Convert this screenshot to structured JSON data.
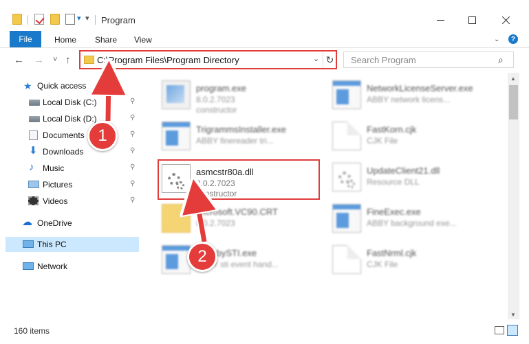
{
  "window": {
    "title": "Program",
    "quick_access_dropdown": "▾",
    "minimize": "—",
    "maximize": "☐",
    "close": "✕"
  },
  "ribbon": {
    "tabs": [
      "File",
      "Home",
      "Share",
      "View"
    ],
    "expand_glyph": "⌄",
    "help_glyph": "?"
  },
  "nav_buttons": {
    "back": "←",
    "forward": "→",
    "recent": "˅",
    "up": "↑"
  },
  "address": {
    "path": "C:\\Program Files\\Program Directory",
    "dropdown_glyph": "⌄",
    "refresh_glyph": "↻"
  },
  "search": {
    "placeholder": "Search Program",
    "icon_glyph": "⌕"
  },
  "sidebar": {
    "pin_glyph": "📌",
    "items": [
      {
        "label": "Quick access",
        "icon": "star-icon",
        "pinned": false
      },
      {
        "label": "Local Disk (C:)",
        "icon": "disk-icon",
        "pinned": true
      },
      {
        "label": "Local Disk (D:)",
        "icon": "disk-icon",
        "pinned": true
      },
      {
        "label": "Documents",
        "icon": "documents-icon",
        "pinned": true
      },
      {
        "label": "Downloads",
        "icon": "download-icon",
        "pinned": true
      },
      {
        "label": "Music",
        "icon": "music-icon",
        "pinned": true
      },
      {
        "label": "Pictures",
        "icon": "pictures-icon",
        "pinned": true
      },
      {
        "label": "Videos",
        "icon": "videos-icon",
        "pinned": true
      },
      {
        "label": "OneDrive",
        "icon": "cloud-icon",
        "pinned": false
      },
      {
        "label": "This PC",
        "icon": "computer-icon",
        "pinned": false,
        "selected": true
      },
      {
        "label": "Network",
        "icon": "network-icon",
        "pinned": false
      }
    ]
  },
  "files": [
    {
      "name": "program.exe",
      "line2": "8.0.2.7023",
      "line3": "constructor",
      "icon": "setup-exe-icon"
    },
    {
      "name": "NetworkLicenseServer.exe",
      "line2": "ABBY network licens...",
      "line3": "",
      "icon": "exe-icon"
    },
    {
      "name": "TrigrammsInstaller.exe",
      "line2": "ABBY finereader tri...",
      "line3": "",
      "icon": "exe-icon"
    },
    {
      "name": "FastKorn.cjk",
      "line2": "CJK File",
      "line3": "",
      "icon": "document-icon"
    },
    {
      "name": "asmcstr80a.dll",
      "line2": "8.0.2.7023",
      "line3": "constructor",
      "icon": "dll-gear-icon",
      "highlighted": true
    },
    {
      "name": "UpdateClient21.dll",
      "line2": "Resource DLL",
      "line3": "",
      "icon": "dll-gear-icon"
    },
    {
      "name": "Microsoft.VC90.CRT",
      "line2": "8.0.2.7023",
      "line3": "",
      "icon": "folder-icon"
    },
    {
      "name": "FineExec.exe",
      "line2": "ABBY background exe...",
      "line3": "",
      "icon": "exe-icon"
    },
    {
      "name": "ScanbySTI.exe",
      "line2": "ABBY sti event hand...",
      "line3": "",
      "icon": "exe-icon"
    },
    {
      "name": "FastNrml.cjk",
      "line2": "CJK File",
      "line3": "",
      "icon": "document-icon"
    }
  ],
  "scrollbar": {
    "up": "▲",
    "down": "▼"
  },
  "status": {
    "item_count": "160 items"
  },
  "steps": [
    "1",
    "2"
  ],
  "colors": {
    "accent": "#1979ca",
    "highlight_red": "#e03c3c",
    "badge_red": "#e43b3b",
    "selection": "#cce8ff"
  }
}
